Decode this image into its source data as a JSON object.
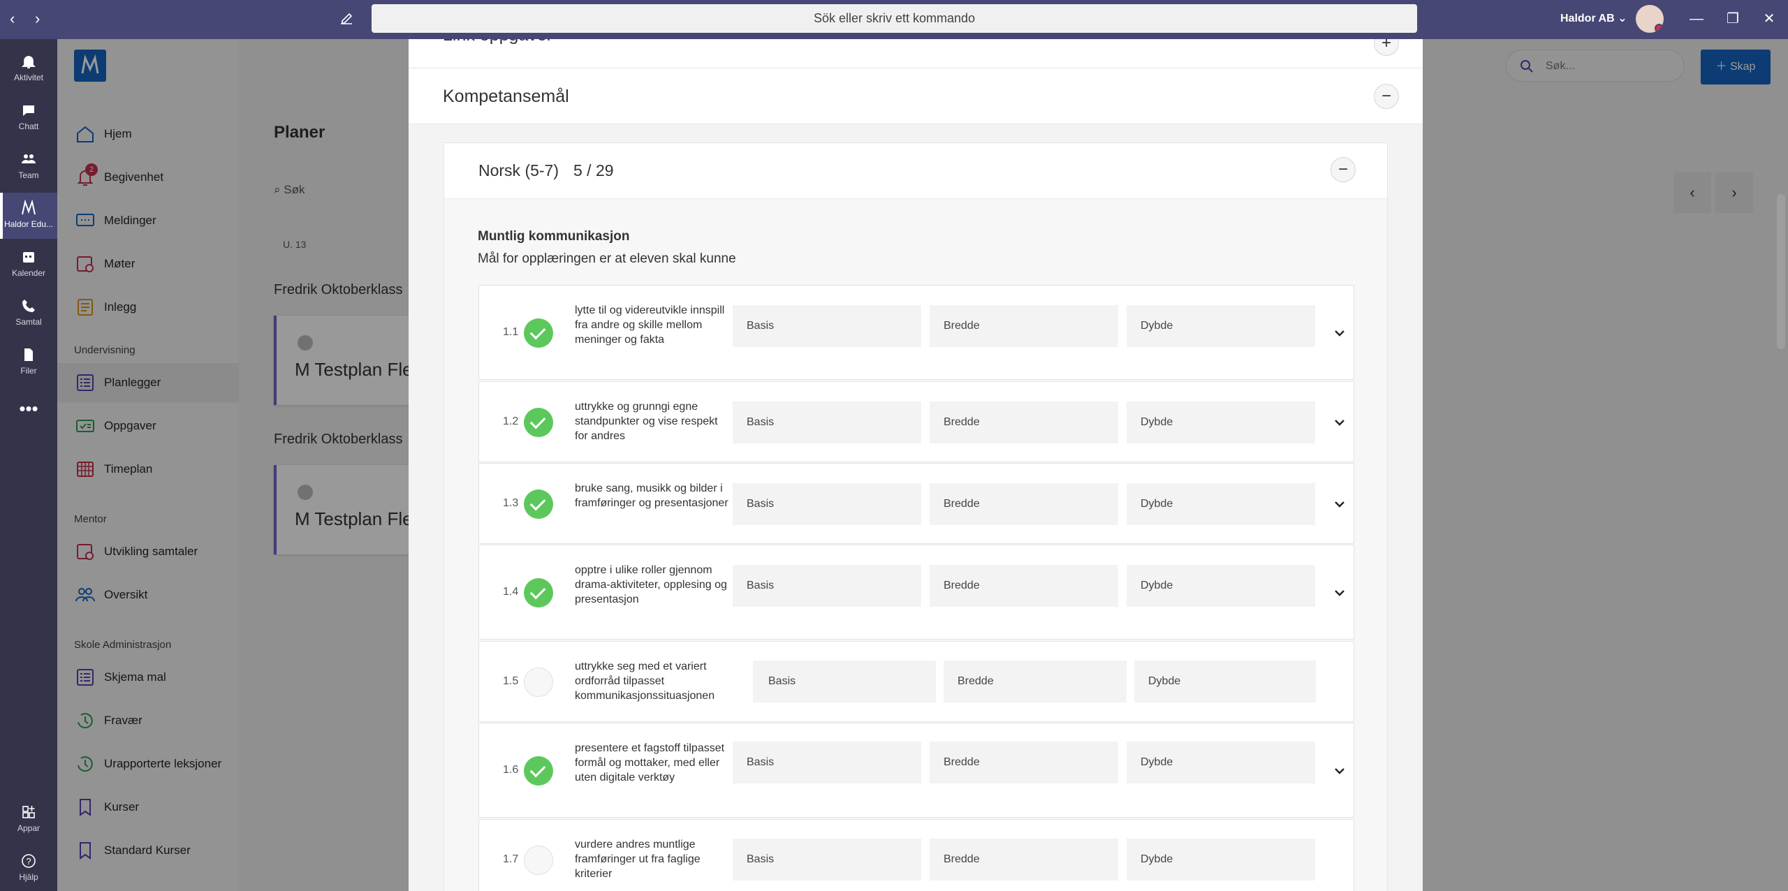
{
  "titlebar": {
    "search_placeholder": "Sök eller skriv ett kommando",
    "org": "Haldor AB ⌄"
  },
  "rail": [
    {
      "label": "Aktivitet",
      "icon": "bell-icon"
    },
    {
      "label": "Chatt",
      "icon": "chat-icon"
    },
    {
      "label": "Team",
      "icon": "team-icon"
    },
    {
      "label": "Haldor Edu...",
      "icon": "haldor-icon"
    },
    {
      "label": "Kalender",
      "icon": "calendar-icon"
    },
    {
      "label": "Samtal",
      "icon": "phone-icon"
    },
    {
      "label": "Filer",
      "icon": "file-icon"
    },
    {
      "label": "Appar",
      "icon": "apps-icon"
    },
    {
      "label": "Hjälp",
      "icon": "help-icon"
    }
  ],
  "nav": {
    "items": [
      {
        "label": "Hjem",
        "icon": "home-icon"
      },
      {
        "label": "Begivenhet",
        "icon": "bell-icon",
        "badge": "2"
      },
      {
        "label": "Meldinger",
        "icon": "message-icon"
      },
      {
        "label": "Møter",
        "icon": "meeting-icon"
      },
      {
        "label": "Inlegg",
        "icon": "post-icon"
      },
      {
        "label": "Planlegger",
        "icon": "planner-icon"
      },
      {
        "label": "Oppgaver",
        "icon": "tasks-icon"
      },
      {
        "label": "Timeplan",
        "icon": "schedule-icon"
      },
      {
        "label": "Utvikling samtaler",
        "icon": "talk-icon"
      },
      {
        "label": "Oversikt",
        "icon": "people-icon"
      },
      {
        "label": "Skjema mal",
        "icon": "form-icon"
      },
      {
        "label": "Fravær",
        "icon": "absence-icon"
      },
      {
        "label": "Urapporterte leksjoner",
        "icon": "lesson-icon"
      },
      {
        "label": "Kurser",
        "icon": "course-icon"
      },
      {
        "label": "Standard Kurser",
        "icon": "course-icon"
      }
    ],
    "sections": [
      "Undervisning",
      "Mentor",
      "Skole Administrasjon"
    ]
  },
  "background": {
    "page_title": "Planer",
    "search_label": "Søk",
    "week": "U. 13",
    "class_1": "Fredrik Oktoberklass",
    "class_2": "Fredrik Oktoberklass",
    "plan_1": "M Testplan Fle",
    "plan_2": "M Testplan Fle",
    "right_search_placeholder": "Søk...",
    "create_label": "Skap"
  },
  "modal": {
    "section_top": "Link oppgaver",
    "section": "Kompetansemål",
    "subject": "Norsk (5-7)",
    "subject_count": "5 / 29",
    "area_title": "Muntlig kommunikasjon",
    "area_subtitle": "Mål for opplæringen er at eleven skal kunne",
    "goals": [
      {
        "num": "1.1",
        "done": true,
        "text": "lytte til og videreutvikle innspill fra andre og skille mellom meninger og fakta"
      },
      {
        "num": "1.2",
        "done": true,
        "text": "uttrykke og grunngi egne standpunkter og vise respekt for andres"
      },
      {
        "num": "1.3",
        "done": true,
        "text": "bruke sang, musikk og bilder i framføringer og presentasjoner"
      },
      {
        "num": "1.4",
        "done": true,
        "text": "opptre i ulike roller gjennom drama-aktiviteter, opplesing og presentasjon"
      },
      {
        "num": "1.5",
        "done": false,
        "text": "uttrykke seg med et variert ordforråd tilpasset kommunikasjonssituasjonen"
      },
      {
        "num": "1.6",
        "done": true,
        "text": "presentere et fagstoff tilpasset formål og mottaker, med eller uten digitale verktøy"
      },
      {
        "num": "1.7",
        "done": false,
        "text": "vurdere andres muntlige framføringer ut fra faglige kriterier"
      }
    ],
    "levels": [
      "Basis",
      "Bredde",
      "Dybde"
    ]
  }
}
